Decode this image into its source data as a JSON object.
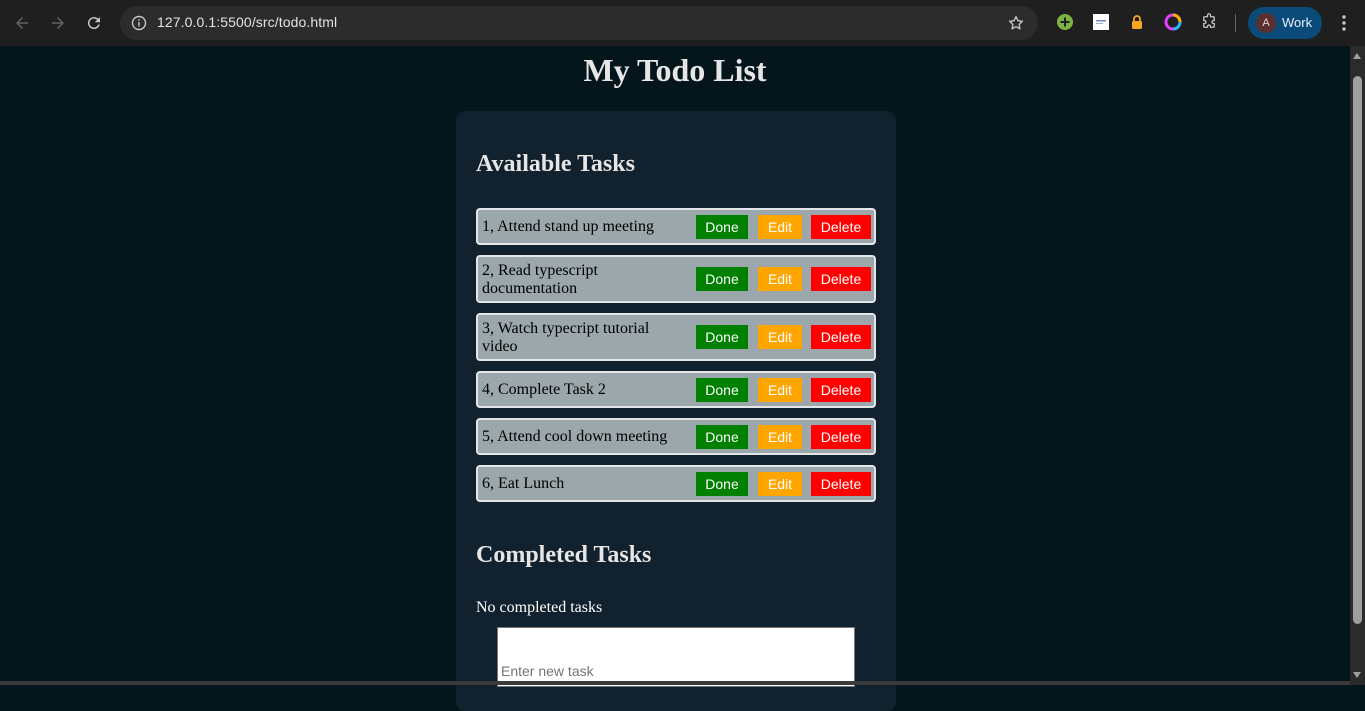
{
  "browser": {
    "url": "127.0.0.1:5500/src/todo.html",
    "profile_initial": "A",
    "profile_name": "Work",
    "icons": [
      "back-arrow-icon",
      "forward-arrow-icon",
      "reload-icon",
      "site-info-icon",
      "bookmark-star-icon",
      "green-plus-extension-icon",
      "white-extension-icon",
      "lock-extension-icon",
      "color-ring-extension-icon",
      "puzzle-extensions-icon",
      "more-menu-icon"
    ]
  },
  "page": {
    "title": "My Todo List",
    "available_heading": "Available Tasks",
    "completed_heading": "Completed Tasks",
    "no_completed_message": "No completed tasks",
    "input_placeholder": "Enter new task"
  },
  "buttons": {
    "done": "Done",
    "edit": "Edit",
    "delete": "Delete"
  },
  "tasks": [
    {
      "text": "1, Attend stand up meeting"
    },
    {
      "text": "2, Read typescript documentation"
    },
    {
      "text": "3, Watch typecript tutorial video"
    },
    {
      "text": "4, Complete Task 2"
    },
    {
      "text": "5, Attend cool down meeting"
    },
    {
      "text": "6, Eat Lunch"
    }
  ],
  "colors": {
    "background": "#04151c",
    "card": "#11212d",
    "task": "#9ba7ab",
    "done": "#008000",
    "edit": "#ffa500",
    "delete": "#ff0000"
  }
}
